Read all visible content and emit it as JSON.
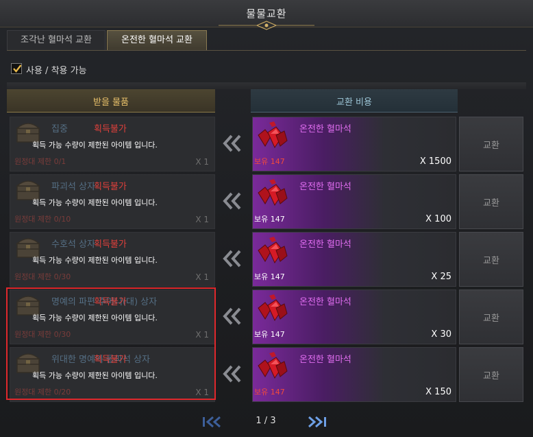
{
  "window": {
    "title": "물물교환"
  },
  "tabs": [
    {
      "label": "조각난 혈마석 교환",
      "active": false
    },
    {
      "label": "온전한 혈마석 교환",
      "active": true
    }
  ],
  "filter": {
    "label": "사용 / 착용 가능",
    "checked": true
  },
  "columns": {
    "receive": "받을 물품",
    "cost": "교환 비용"
  },
  "rows": [
    {
      "item_name": "집중",
      "status": "획득불가",
      "limit_message": "획득 가능 수량이 제한된 아이템 입니다.",
      "limit_count": "원정대 제한 0/1",
      "quantity": "X 1",
      "cost_name": "온전한 혈마석",
      "owned": "보유 147",
      "owned_insufficient": true,
      "price": "X 1500",
      "button": "교환"
    },
    {
      "item_name": "파괴석 상자",
      "status": "획득불가",
      "limit_message": "획득 가능 수량이 제한된 아이템 입니다.",
      "limit_count": "원정대 제한 0/10",
      "quantity": "X 1",
      "cost_name": "온전한 혈마석",
      "owned": "보유 147",
      "owned_insufficient": false,
      "price": "X 100",
      "button": "교환"
    },
    {
      "item_name": "수호석 상자",
      "status": "획득불가",
      "limit_message": "획득 가능 수량이 제한된 아이템 입니다.",
      "limit_count": "원정대 제한 0/30",
      "quantity": "X 1",
      "cost_name": "온전한 혈마석",
      "owned": "보유 147",
      "owned_insufficient": false,
      "price": "X 25",
      "button": "교환"
    },
    {
      "item_name": "명예의 파편 주머니(대) 상자",
      "status": "획득불가",
      "limit_message": "획득 가능 수량이 제한된 아이템 입니다.",
      "limit_count": "원정대 제한 0/30",
      "quantity": "X 1",
      "cost_name": "온전한 혈마석",
      "owned": "보유 147",
      "owned_insufficient": false,
      "price": "X 30",
      "button": "교환"
    },
    {
      "item_name": "위대한 명예의 돌파석 상자",
      "status": "획득불가",
      "limit_message": "획득 가능 수량이 제한된 아이템 입니다.",
      "limit_count": "원정대 제한 0/20",
      "quantity": "X 1",
      "cost_name": "온전한 혈마석",
      "owned": "보유 147",
      "owned_insufficient": true,
      "price": "X 150",
      "button": "교환"
    }
  ],
  "pagination": {
    "indicator": "1 / 3"
  },
  "colors": {
    "unavailable": "#e0403b",
    "cost_name": "#e06df0",
    "highlight": "#e0282c",
    "tab_active": "#8a7a52"
  },
  "icons": {
    "item": "treasure-chest-icon",
    "cost": "blood-stone-gem-icon",
    "arrow": "double-chevron-left-icon"
  }
}
